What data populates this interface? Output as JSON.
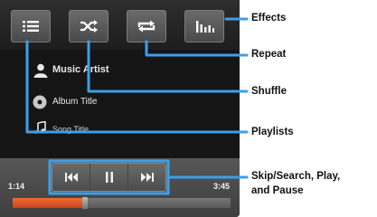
{
  "toolbar": {
    "icons": [
      "playlist-icon",
      "shuffle-icon",
      "repeat-icon",
      "equalizer-icon"
    ]
  },
  "track": {
    "artist": "Music Artist",
    "album": "Album Title",
    "song": "Song Title"
  },
  "transport": {
    "icons": [
      "skip-back-icon",
      "pause-icon",
      "skip-forward-icon"
    ]
  },
  "time": {
    "elapsed": "1:14",
    "total": "3:45",
    "progress_fraction": 0.33
  },
  "callouts": {
    "effects": "Effects",
    "repeat": "Repeat",
    "shuffle": "Shuffle",
    "playlists": "Playlists",
    "transport_line1": "Skip/Search, Play,",
    "transport_line2": "and Pause"
  },
  "colors": {
    "callout": "#3d9fe8",
    "progress": "#e8582a"
  }
}
